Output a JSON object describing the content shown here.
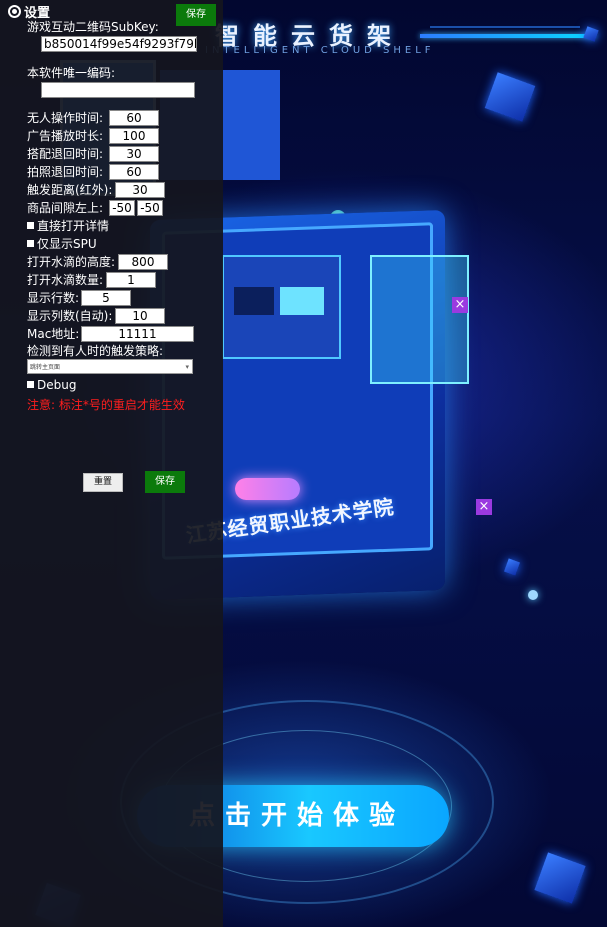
{
  "background_app": {
    "title": "智能云货架",
    "subtitle": "INTELLIGENT CLOUD SHELF",
    "school_name": "江苏经贸职业技术学院",
    "start_button": "点击开始体验",
    "colors": {
      "accent": "#19c8ff",
      "base": "#02052a"
    }
  },
  "settings": {
    "header": "设置",
    "icon": "gear-icon",
    "top_save_label": "保存",
    "subkey_label": "游戏互动二维码SubKey:",
    "subkey_value": "b850014f99e54f9293f79b",
    "unique_code_label": "本软件唯一编码:",
    "unique_code_value": "",
    "fields": {
      "idle_time": {
        "label": "无人操作时间:",
        "value": "60"
      },
      "ad_duration": {
        "label": "广告播放时长:",
        "value": "100"
      },
      "match_return": {
        "label": "搭配退回时间:",
        "value": "30"
      },
      "photo_return": {
        "label": "拍照退回时间:",
        "value": "60"
      },
      "trigger_distance": {
        "label": "触发距离(红外):",
        "value": "30"
      },
      "item_gap": {
        "label": "商品间隙左上:",
        "value1": "-50",
        "value2": "-50"
      },
      "drop_height": {
        "label": "打开水滴的高度:",
        "value": "800"
      },
      "drop_count": {
        "label": "打开水滴数量:",
        "value": "1"
      },
      "rows": {
        "label": "显示行数:",
        "value": "5"
      },
      "cols": {
        "label": "显示列数(自动):",
        "value": "10"
      },
      "mac": {
        "label": "Mac地址:",
        "value": "11111"
      }
    },
    "checkbox_direct_open": "直接打开详情",
    "checkbox_spu_only": "仅显示SPU",
    "strategy_label": "检测到有人时的触发策略:",
    "strategy_selected": "跳转主页面",
    "checkbox_debug": "Debug",
    "warning": "注意: 标注*号的重启才能生效",
    "reset_label": "重置",
    "bottom_save_label": "保存",
    "colors": {
      "save_green": "#0b7a0b",
      "warning_red": "#ff1e1e"
    }
  }
}
